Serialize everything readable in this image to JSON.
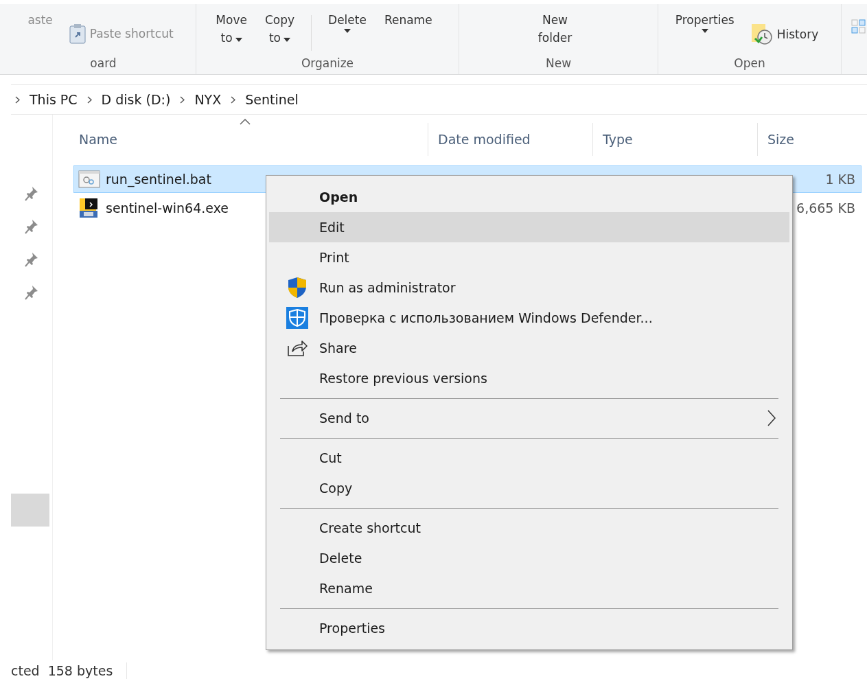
{
  "ribbon": {
    "groups": [
      {
        "label": "oard",
        "items": [
          {
            "kind": "large",
            "label": "aste",
            "disabled": true
          },
          {
            "kind": "small",
            "label": "Paste shortcut",
            "disabled": true
          }
        ]
      },
      {
        "label": "Organize",
        "items": [
          {
            "kind": "large",
            "label": "Move to",
            "dropdown": true,
            "disabled": false
          },
          {
            "kind": "large",
            "label": "Copy to",
            "dropdown": true,
            "disabled": false
          },
          {
            "kind": "divider"
          },
          {
            "kind": "split",
            "label": "Delete",
            "disabled": false
          },
          {
            "kind": "large",
            "label": "Rename",
            "disabled": false
          }
        ]
      },
      {
        "label": "New",
        "items": [
          {
            "kind": "large",
            "label": "New folder",
            "disabled": false
          }
        ]
      },
      {
        "label": "Open",
        "items": [
          {
            "kind": "split",
            "label": "Properties",
            "disabled": false
          },
          {
            "kind": "small",
            "label": "History",
            "disabled": false
          }
        ]
      }
    ]
  },
  "breadcrumb": [
    "This PC",
    "D disk (D:)",
    "NYX",
    "Sentinel"
  ],
  "columns": [
    "Name",
    "Date modified",
    "Type",
    "Size"
  ],
  "files": [
    {
      "name": "run_sentinel.bat",
      "kind": "bat",
      "size": "1 KB",
      "selected": true
    },
    {
      "name": "sentinel-win64.exe",
      "kind": "exe",
      "size": "6,665 KB",
      "selected": false
    }
  ],
  "context_menu": [
    {
      "kind": "item",
      "label": "Open",
      "default": true,
      "selected": false
    },
    {
      "kind": "item",
      "label": "Edit",
      "default": false,
      "selected": true
    },
    {
      "kind": "item",
      "label": "Print",
      "default": false,
      "selected": false
    },
    {
      "kind": "shield",
      "label": "Run as administrator",
      "default": false,
      "selected": false
    },
    {
      "kind": "defender",
      "label": "Проверка с использованием Windows Defender...",
      "default": false,
      "selected": false
    },
    {
      "kind": "share",
      "label": "Share",
      "default": false,
      "selected": false
    },
    {
      "kind": "item",
      "label": "Restore previous versions",
      "default": false,
      "selected": false
    },
    {
      "kind": "separator"
    },
    {
      "kind": "submenu",
      "label": "Send to",
      "default": false,
      "selected": false
    },
    {
      "kind": "separator"
    },
    {
      "kind": "item",
      "label": "Cut",
      "default": false,
      "selected": false
    },
    {
      "kind": "item",
      "label": "Copy",
      "default": false,
      "selected": false
    },
    {
      "kind": "separator"
    },
    {
      "kind": "item",
      "label": "Create shortcut",
      "default": false,
      "selected": false
    },
    {
      "kind": "item",
      "label": "Delete",
      "default": false,
      "selected": false
    },
    {
      "kind": "item",
      "label": "Rename",
      "default": false,
      "selected": false
    },
    {
      "kind": "separator"
    },
    {
      "kind": "item",
      "label": "Properties",
      "default": false,
      "selected": false
    }
  ],
  "status_bar": [
    "cted",
    "158 bytes"
  ]
}
